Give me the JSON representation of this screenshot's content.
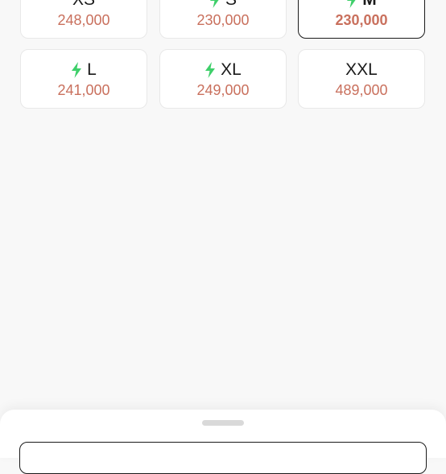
{
  "size_options": [
    {
      "size": "XS",
      "price": "248,000",
      "express": false,
      "selected": false
    },
    {
      "size": "S",
      "price": "230,000",
      "express": true,
      "selected": false
    },
    {
      "size": "M",
      "price": "230,000",
      "express": true,
      "selected": true
    },
    {
      "size": "L",
      "price": "241,000",
      "express": true,
      "selected": false
    },
    {
      "size": "XL",
      "price": "249,000",
      "express": true,
      "selected": false
    },
    {
      "size": "XXL",
      "price": "489,000",
      "express": false,
      "selected": false
    }
  ],
  "colors": {
    "price": "#c9705d",
    "bolt": "#3ecf6a",
    "selected_border": "#1a1a1a"
  },
  "icons": {
    "express": "lightning-bolt-icon"
  }
}
